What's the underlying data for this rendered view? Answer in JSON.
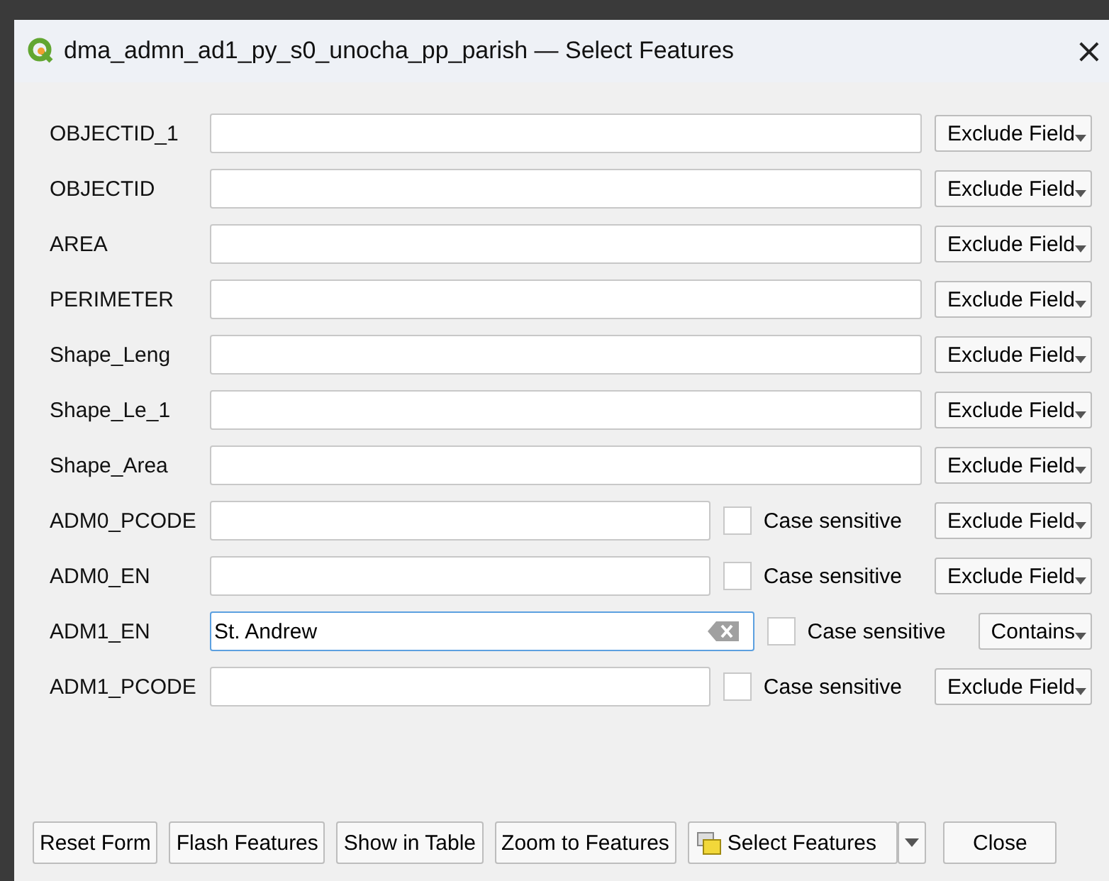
{
  "window": {
    "title": "dma_admn_ad1_py_s0_unocha_pp_parish — Select Features",
    "close": "×"
  },
  "fields": [
    {
      "label": "OBJECTID_1",
      "operator": "Exclude Field",
      "focused": false
    },
    {
      "label": "OBJECTID",
      "operator": "Exclude Field",
      "focused": false
    },
    {
      "label": "AREA",
      "operator": "Exclude Field",
      "focused": false
    },
    {
      "label": "PERIMETER",
      "operator": "Exclude Field",
      "focused": false
    },
    {
      "label": "Shape_Leng",
      "operator": "Exclude Field",
      "focused": false
    },
    {
      "label": "Shape_Le_1",
      "operator": "Exclude Field",
      "focused": false
    },
    {
      "label": "Shape_Area",
      "operator": "Exclude Field",
      "focused": false
    },
    {
      "label": "ADM0_PCODE",
      "case_label": "Case sensitive",
      "case_checked": false,
      "operator": "Exclude Field",
      "focused": false
    },
    {
      "label": "ADM0_EN",
      "case_label": "Case sensitive",
      "case_checked": false,
      "operator": "Exclude Field",
      "focused": false
    },
    {
      "label": "ADM1_EN",
      "value": "St. Andrew",
      "case_label": "Case sensitive",
      "case_checked": false,
      "operator": "Contains",
      "focused": true
    },
    {
      "label": "ADM1_PCODE",
      "case_label": "Case sensitive",
      "case_checked": false,
      "operator": "Exclude Field",
      "focused": false
    }
  ],
  "buttons": [
    {
      "kind": "plain",
      "label": "Reset Form"
    },
    {
      "kind": "plain",
      "label": "Flash Features"
    },
    {
      "kind": "plain",
      "label": "Show in Table"
    },
    {
      "kind": "plain",
      "label": "Zoom to Features"
    },
    {
      "kind": "split",
      "label": "Select Features"
    },
    {
      "kind": "plain",
      "label": "Close"
    }
  ]
}
